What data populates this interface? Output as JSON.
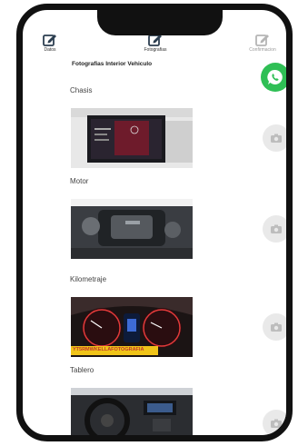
{
  "tabs": [
    {
      "label": "Datos",
      "icon": "edit-icon",
      "active": true
    },
    {
      "label": "Fotografias",
      "icon": "edit-icon",
      "active": true
    },
    {
      "label": "Confirmacion",
      "icon": "edit-icon",
      "active": false
    }
  ],
  "page_title": "Fotografias Interior Vehiculo",
  "sections": [
    {
      "label": "Chasis",
      "photo": "dashboard-screen-photo"
    },
    {
      "label": "Motor",
      "photo": "engine-photo"
    },
    {
      "label": "Kilometraje",
      "photo": "odometer-photo",
      "photo_caption": "YT5RMWKELLAFOTOGRAFIA"
    },
    {
      "label": "Tablero",
      "photo": "steering-wheel-photo"
    }
  ],
  "colors": {
    "whatsapp": "#2fbf55",
    "camera_button": "#e9e9e9",
    "frame": "#111111"
  }
}
